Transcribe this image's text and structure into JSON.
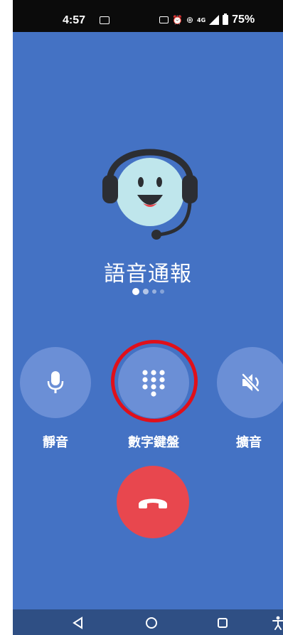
{
  "status_bar": {
    "time": "4:57",
    "network_label": "4G",
    "battery_percent": "75%"
  },
  "call": {
    "caller_name": "語音通報",
    "page_indicator": {
      "total": 4,
      "active_index": 0
    }
  },
  "controls": {
    "mute_label": "靜音",
    "keypad_label": "數字鍵盤",
    "speaker_label": "擴音"
  },
  "icons": {
    "mute": "microphone-icon",
    "keypad": "dialpad-icon",
    "speaker": "speaker-muted-icon",
    "end_call": "phone-hangup-icon",
    "avatar": "headset-avatar-icon"
  },
  "colors": {
    "background": "#4472c4",
    "control_button": "#6b8fd6",
    "end_call_button": "#e8474e",
    "highlight_ring": "#e0101a",
    "nav_bar": "#2f4f84",
    "avatar_face": "#bfe6ec",
    "headset": "#2c2e33"
  }
}
